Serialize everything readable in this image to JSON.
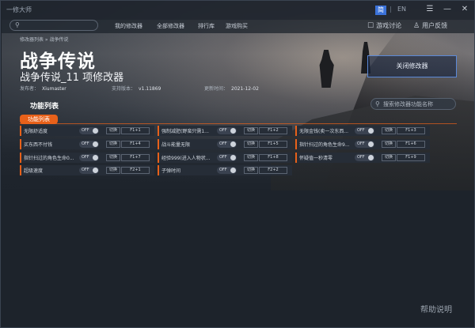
{
  "window": {
    "app_name": "一修大师"
  },
  "lang": {
    "cn": "简",
    "sep": "|",
    "en": "EN"
  },
  "controls": {
    "menu": "☰",
    "min": "—",
    "close": "✕"
  },
  "nav": {
    "search_placeholder": "",
    "items": [
      "我的修改器",
      "全部修改器",
      "排行库",
      "游戏购买"
    ],
    "right": [
      {
        "icon": "chat-icon",
        "glyph": "☐",
        "label": "游戏讨论"
      },
      {
        "icon": "user-feedback-icon",
        "glyph": "♙",
        "label": "用户反馈"
      }
    ]
  },
  "breadcrumb": "修改器列表 » 战争传说",
  "game": {
    "title": "战争传说",
    "trainer_title": "战争传说_11 项修改器",
    "publisher_label": "发布者：",
    "publisher": "Xiumaster",
    "version_label": "支持版本：",
    "version": "v1.11869",
    "updated_label": "更新时间：",
    "updated": "2021-12-02"
  },
  "close_trainer_label": "关闭修改器",
  "section_title": "功能列表",
  "func_search_placeholder": "搜索修改器功能名称",
  "tab_badge": "功能列表",
  "toggle_text": "OFF",
  "hotkey_label": "切换",
  "cheats": [
    {
      "label": "无限舒适度",
      "key": "F1+1"
    },
    {
      "label": "强制减肥(野蛮只需1...",
      "key": "F1+2"
    },
    {
      "label": "无限金钱(卖一次东西...",
      "key": "F1+3"
    },
    {
      "label": "买东西不付钱",
      "key": "F1+4"
    },
    {
      "label": "战斗能量无限",
      "key": "F1+5"
    },
    {
      "label": "指针扫过的角色生命9...",
      "key": "F1+6"
    },
    {
      "label": "指针扫过的角色生命0...",
      "key": "F1+7"
    },
    {
      "label": "经验999(进入人物状...",
      "key": "F1+8"
    },
    {
      "label": "怀疑值一秒清零",
      "key": "F1+9"
    },
    {
      "label": "超级速度",
      "key": "F2+1"
    },
    {
      "label": "子弹时间",
      "key": "F2+2"
    }
  ],
  "help_label": "帮助说明"
}
